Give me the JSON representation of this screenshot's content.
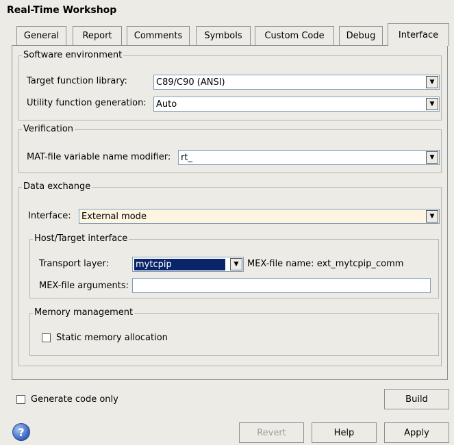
{
  "window": {
    "title": "Real-Time Workshop"
  },
  "tabs": [
    {
      "label": "General"
    },
    {
      "label": "Report"
    },
    {
      "label": "Comments"
    },
    {
      "label": "Symbols"
    },
    {
      "label": "Custom Code"
    },
    {
      "label": "Debug"
    },
    {
      "label": "Interface",
      "active": true
    }
  ],
  "software_environment": {
    "title": "Software environment",
    "target_lib_label": "Target function library:",
    "target_lib_value": "C89/C90 (ANSI)",
    "utility_label": "Utility function generation:",
    "utility_value": "Auto"
  },
  "verification": {
    "title": "Verification",
    "modifier_label": "MAT-file variable name modifier:",
    "modifier_value": "rt_"
  },
  "data_exchange": {
    "title": "Data exchange",
    "interface_label": "Interface:",
    "interface_value": "External mode",
    "host_target": {
      "title": "Host/Target interface",
      "transport_label": "Transport layer:",
      "transport_value": "mytcpip",
      "mex_name_label": "MEX-file name: ext_mytcpip_comm",
      "mex_args_label": "MEX-file arguments:",
      "mex_args_value": ""
    },
    "memory": {
      "title": "Memory management",
      "static_alloc_label": "Static memory allocation",
      "static_alloc_checked": false
    }
  },
  "footer": {
    "generate_code_only_label": "Generate code only",
    "generate_code_only_checked": false,
    "build_label": "Build",
    "revert_label": "Revert",
    "help_label": "Help",
    "apply_label": "Apply",
    "help_icon_glyph": "?"
  },
  "colors": {
    "background": "#ecebe6",
    "selection": "#0a246a",
    "interface_field": "#fdf5e2"
  }
}
